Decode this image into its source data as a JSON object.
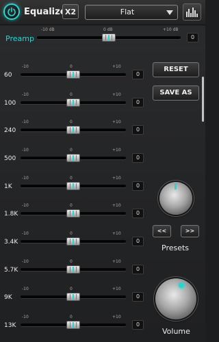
{
  "header": {
    "title": "Equalizer",
    "bass_boost_label": "X2",
    "preset": {
      "selected": "Flat"
    },
    "icons": {
      "power": "power-icon",
      "spectrum": "spectrum-bars-icon",
      "dropdown": "chevron-down-icon"
    }
  },
  "preamp": {
    "label": "Preamp",
    "ticks": [
      "-10 dB",
      "0 dB",
      "+10 dB"
    ],
    "value": "0",
    "level": 0
  },
  "bands": [
    {
      "freq": "60",
      "ticks": [
        "-10",
        "0",
        "+10"
      ],
      "value": "0",
      "level": 0
    },
    {
      "freq": "100",
      "ticks": [
        "-10",
        "0",
        "+10"
      ],
      "value": "0",
      "level": 0
    },
    {
      "freq": "240",
      "ticks": [
        "-10",
        "0",
        "+10"
      ],
      "value": "0",
      "level": 0
    },
    {
      "freq": "500",
      "ticks": [
        "-10",
        "0",
        "+10"
      ],
      "value": "0",
      "level": 0
    },
    {
      "freq": "1K",
      "ticks": [
        "-10",
        "0",
        "+10"
      ],
      "value": "0",
      "level": 0
    },
    {
      "freq": "1.8K",
      "ticks": [
        "-10",
        "0",
        "+10"
      ],
      "value": "0",
      "level": 0
    },
    {
      "freq": "3.4K",
      "ticks": [
        "-10",
        "0",
        "+10"
      ],
      "value": "0",
      "level": 0
    },
    {
      "freq": "5.7K",
      "ticks": [
        "-10",
        "0",
        "+10"
      ],
      "value": "0",
      "level": 0
    },
    {
      "freq": "9K",
      "ticks": [
        "-10",
        "0",
        "+10"
      ],
      "value": "0",
      "level": 0
    },
    {
      "freq": "13K",
      "ticks": [
        "-10",
        "0",
        "+10"
      ],
      "value": "0",
      "level": 0
    }
  ],
  "actions": {
    "reset_label": "RESET",
    "save_as_label": "SAVE AS"
  },
  "presets_control": {
    "label": "Presets",
    "prev_label": "<<",
    "next_label": ">>"
  },
  "volume_control": {
    "label": "Volume"
  },
  "colors": {
    "accent": "#25d7d0",
    "background": "#1f2022",
    "thumb": "#d8d8d8"
  }
}
